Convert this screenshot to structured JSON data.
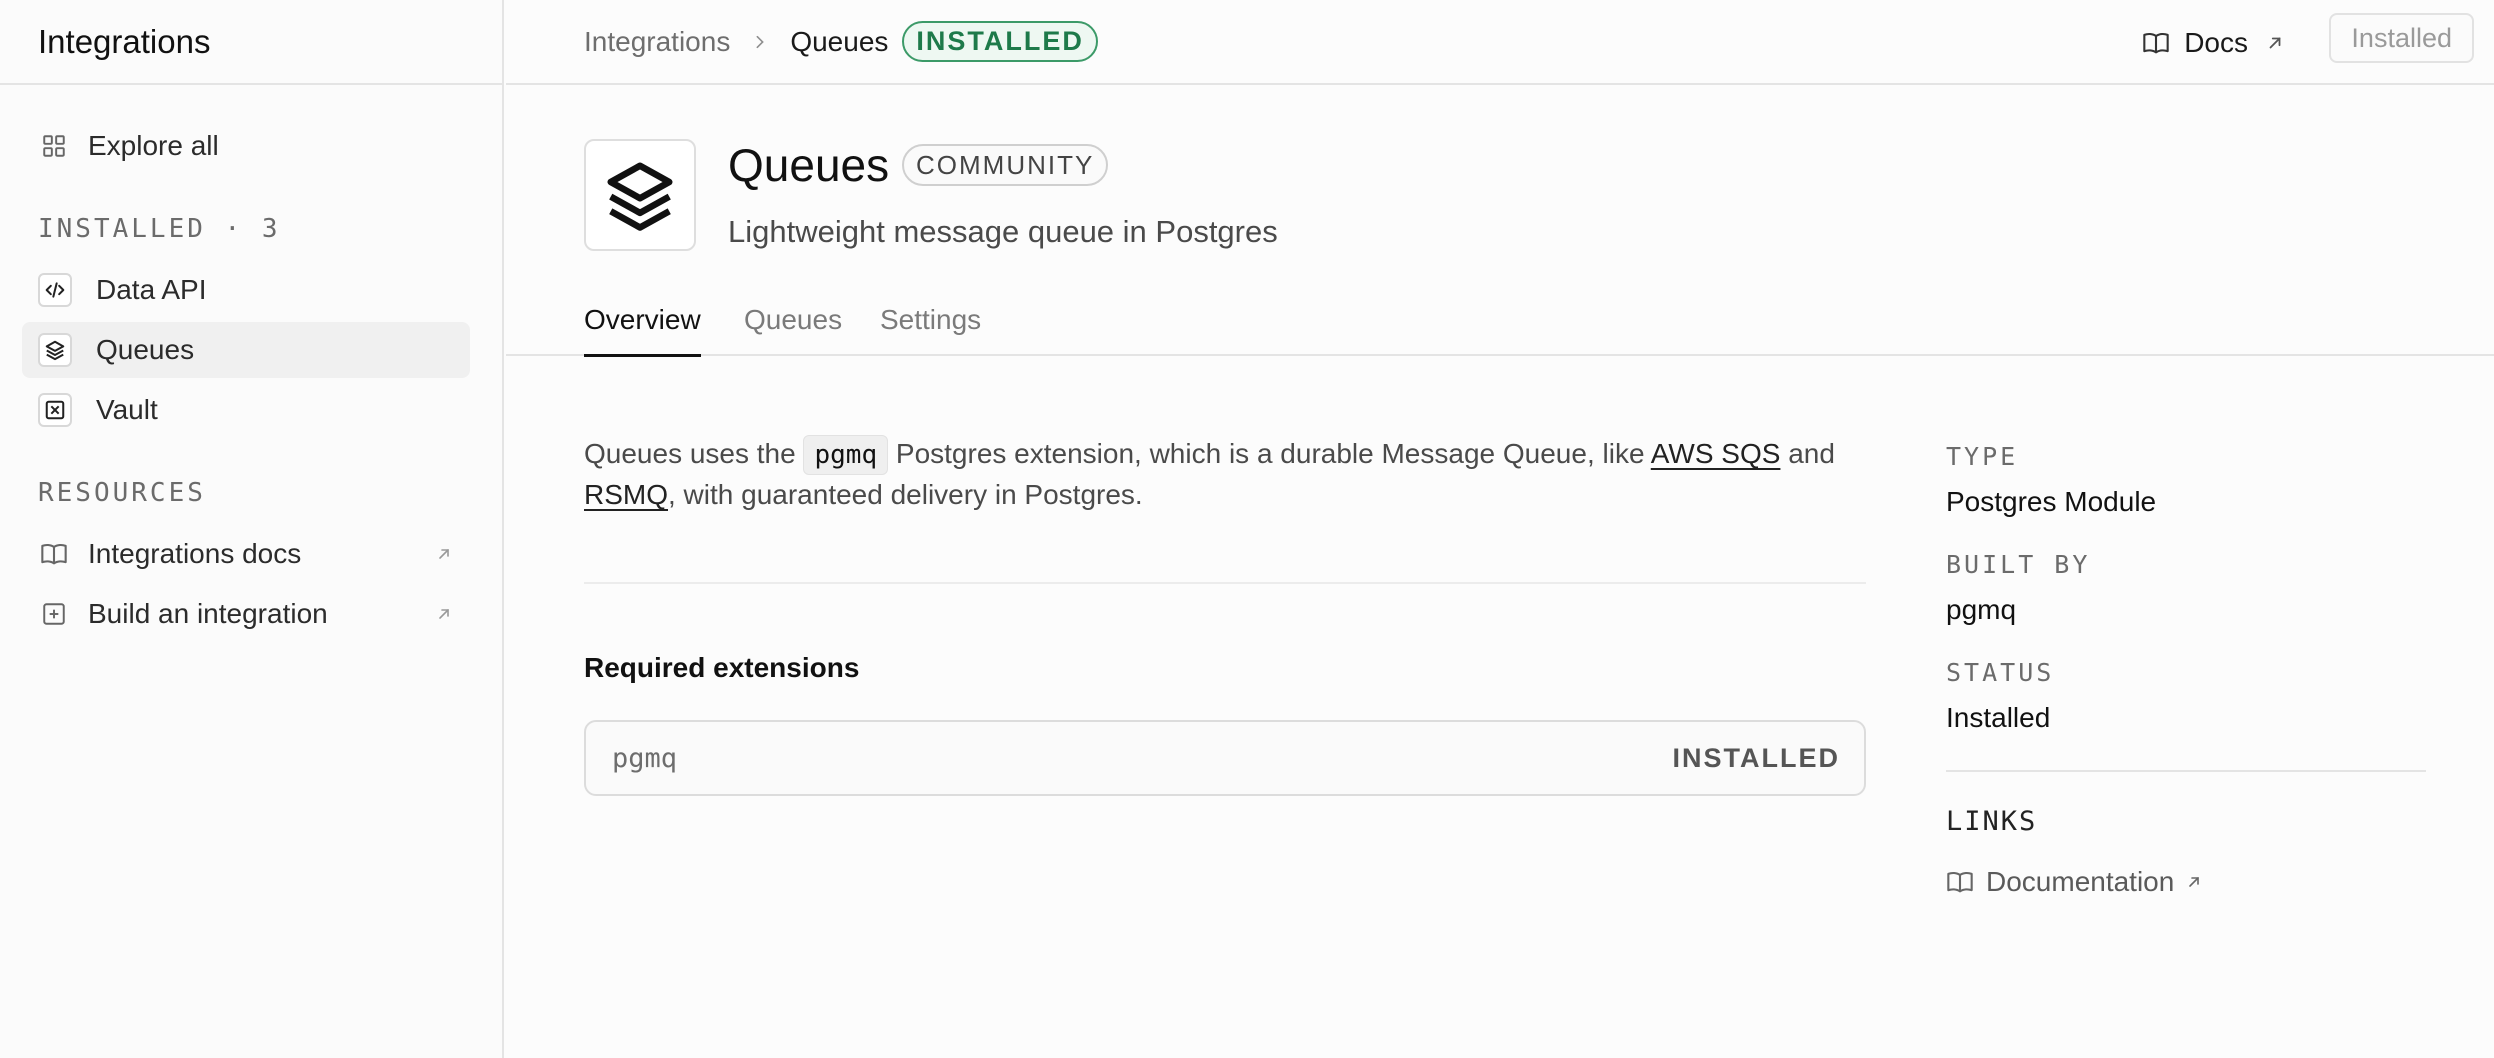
{
  "sidebar": {
    "title": "Integrations",
    "explore_label": "Explore all",
    "installed_section": "INSTALLED · 3",
    "installed_items": [
      {
        "label": "Data API",
        "icon": "code-icon"
      },
      {
        "label": "Queues",
        "icon": "layers-icon"
      },
      {
        "label": "Vault",
        "icon": "vault-icon"
      }
    ],
    "resources_section": "RESOURCES",
    "resource_items": [
      {
        "label": "Integrations docs",
        "icon": "book-icon"
      },
      {
        "label": "Build an integration",
        "icon": "plus-square-icon"
      }
    ]
  },
  "topbar": {
    "breadcrumb_root": "Integrations",
    "breadcrumb_current": "Queues",
    "status_badge": "INSTALLED",
    "docs_label": "Docs",
    "installed_button": "Installed"
  },
  "header": {
    "title": "Queues",
    "badge": "COMMUNITY",
    "description": "Lightweight message queue in Postgres"
  },
  "tabs": [
    "Overview",
    "Queues",
    "Settings"
  ],
  "overview": {
    "intro_part1": "Queues uses the ",
    "intro_code": "pgmq",
    "intro_part2": " Postgres extension, which is a durable Message Queue, like ",
    "link_aws": "AWS SQS",
    "intro_part3": " and ",
    "link_rsmq": "RSMQ",
    "intro_part4": ", with guaranteed delivery in Postgres.",
    "required_title": "Required extensions",
    "extension_name": "pgmq",
    "extension_status": "INSTALLED"
  },
  "meta": {
    "type_label": "TYPE",
    "type_value": "Postgres Module",
    "built_by_label": "BUILT BY",
    "built_by_value": "pgmq",
    "status_label": "STATUS",
    "status_value": "Installed",
    "links_label": "LINKS",
    "documentation_link": "Documentation"
  },
  "colors": {
    "installed_green": "#1e7a4a",
    "border": "#e4e4e4",
    "background": "#fcfcfc"
  }
}
